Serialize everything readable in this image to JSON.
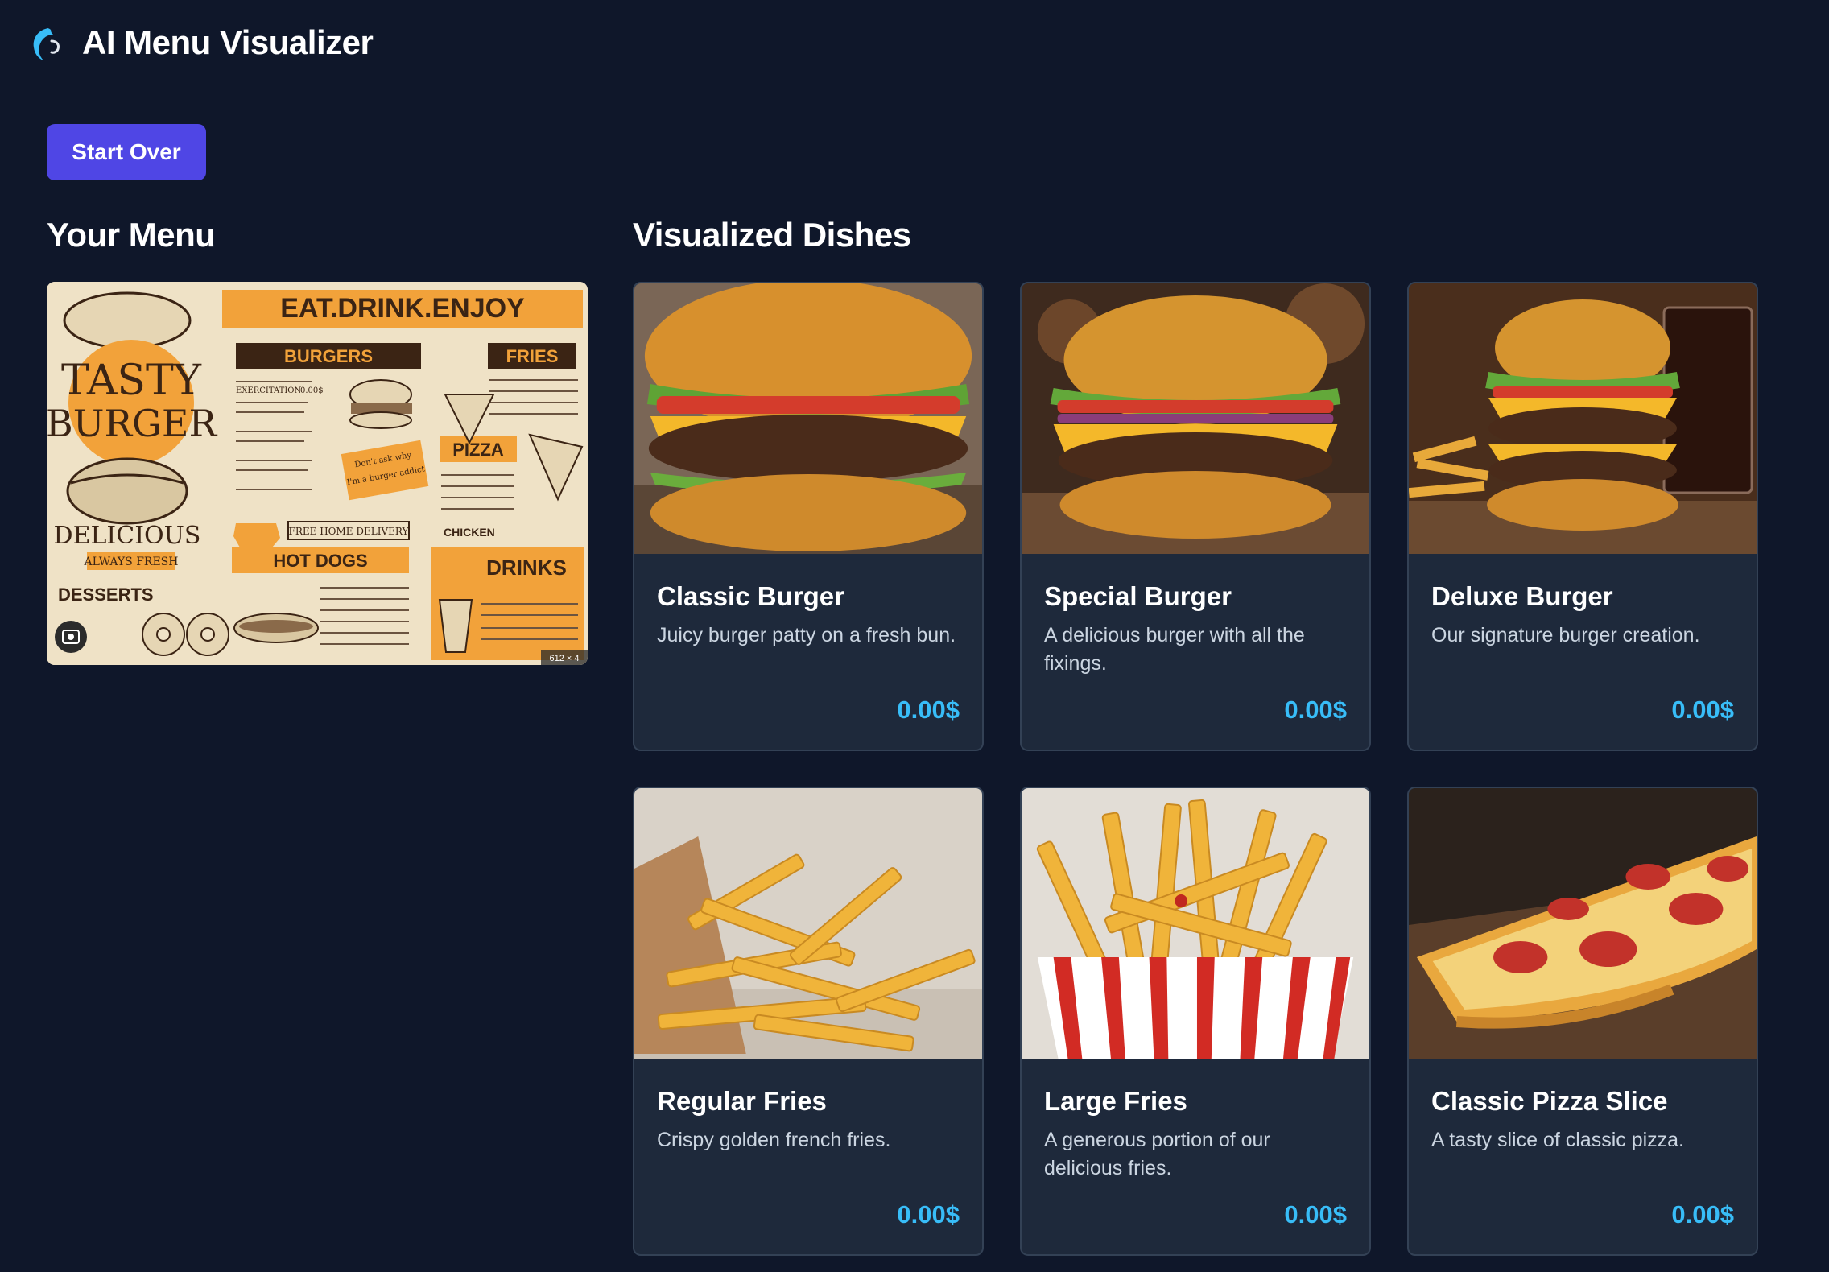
{
  "app": {
    "title": "AI Menu Visualizer",
    "logo_icon": "ai-logo-icon"
  },
  "actions": {
    "start_over_label": "Start Over"
  },
  "sections": {
    "your_menu": "Your Menu",
    "visualized_dishes": "Visualized Dishes"
  },
  "menu_image": {
    "header": "EAT.DRINK.ENJOY",
    "brand_line1": "TASTY",
    "brand_line2": "BURGER",
    "tagline1": "DELICIOUS",
    "tagline2": "ALWAYS FRESH",
    "categories": [
      "BURGERS",
      "FRIES",
      "PIZZA",
      "HOT DOGS",
      "DRINKS",
      "DESSERTS",
      "CHICKEN"
    ],
    "delivery": "FREE HOME DELIVERY",
    "item_label": "EXERCITATION",
    "item_price": "0.00$",
    "handwritten": "Don't ask why",
    "handwritten2": "I'm a burger addict",
    "size_badge": "612 × 4"
  },
  "dishes": [
    {
      "name": "Classic Burger",
      "description": "Juicy burger patty on a fresh bun.",
      "price": "0.00$"
    },
    {
      "name": "Special Burger",
      "description": "A delicious burger with all the fixings.",
      "price": "0.00$"
    },
    {
      "name": "Deluxe Burger",
      "description": "Our signature burger creation.",
      "price": "0.00$"
    },
    {
      "name": "Regular Fries",
      "description": "Crispy golden french fries.",
      "price": "0.00$"
    },
    {
      "name": "Large Fries",
      "description": "A generous portion of our delicious fries.",
      "price": "0.00$"
    },
    {
      "name": "Classic Pizza Slice",
      "description": "A tasty slice of classic pizza.",
      "price": "0.00$"
    }
  ],
  "colors": {
    "background": "#0f172a",
    "card": "#1e293b",
    "accent": "#4f46e5",
    "price": "#38bdf8",
    "menu_orange": "#f2a23a"
  }
}
